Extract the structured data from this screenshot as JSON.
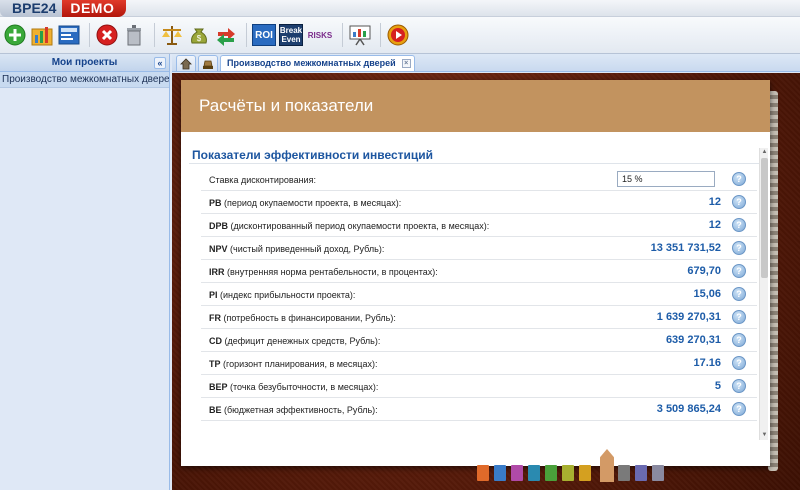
{
  "app": {
    "logo_main": "BPE24",
    "logo_badge": "DEMO"
  },
  "toolbar": {
    "buttons": [
      {
        "icon": "add-icon",
        "color": "#3aa83a"
      },
      {
        "icon": "chart-folder-icon",
        "color": "#f0a020"
      },
      {
        "icon": "plan-icon",
        "color": "#2a6bc0"
      },
      {
        "icon": "delete-icon",
        "color": "#d62020"
      },
      {
        "icon": "trash-icon",
        "color": "#8a8f96"
      },
      {
        "icon": "balance-scale-icon",
        "color": "#c58a1c"
      },
      {
        "icon": "money-bag-icon",
        "color": "#8a9a2a"
      },
      {
        "icon": "exchange-arrows-icon",
        "color": "#d63a2a"
      }
    ],
    "roi_label": "ROI",
    "breakeven_label": "Break Even",
    "risks_label": "RISKS"
  },
  "sidebar": {
    "title": "Мои проекты",
    "collapse_glyph": "«",
    "items": [
      "Производство межкомнатных дверей"
    ]
  },
  "tabs": {
    "active_label": "Производство межкомнатных дверей",
    "close_glyph": "×"
  },
  "panel": {
    "title": "Расчёты и показатели",
    "section_title": "Показатели эффективности инвестиций",
    "discount": {
      "label": "Ставка дисконтирования:",
      "value": "15 %"
    },
    "rows": [
      {
        "abbr": "PB",
        "desc": " (период окупаемости проекта, в месяцах):",
        "value": "12"
      },
      {
        "abbr": "DPB",
        "desc": " (дисконтированный период окупаемости проекта, в месяцах):",
        "value": "12"
      },
      {
        "abbr": "NPV",
        "desc": " (чистый приведенный доход, Рубль):",
        "value": "13 351 731,52"
      },
      {
        "abbr": "IRR",
        "desc": " (внутренняя норма рентабельности, в процентах):",
        "value": "679,70"
      },
      {
        "abbr": "PI",
        "desc": " (индекс прибыльности проекта):",
        "value": "15,06"
      },
      {
        "abbr": "FR",
        "desc": " (потребность в финансировании, Рубль):",
        "value": "1 639 270,31"
      },
      {
        "abbr": "CD",
        "desc": " (дефицит денежных средств, Рубль):",
        "value": "639 270,31"
      },
      {
        "abbr": "TP",
        "desc": " (горизонт планирования, в месяцах):",
        "value": "17.16"
      },
      {
        "abbr": "BEP",
        "desc": " (точка безубыточности, в месяцах):",
        "value": "5"
      },
      {
        "abbr": "BE",
        "desc": " (бюджетная эффективность, Рубль):",
        "value": "3 509 865,24"
      }
    ],
    "help_glyph": "?"
  },
  "bookmarks": {
    "colors": [
      "#e06a2a",
      "#3a7cc8",
      "#b04aa8",
      "#2a8ab0",
      "#4aa03a",
      "#a8b030",
      "#d4a020",
      "#7a7a7a",
      "#6a6ab0",
      "#8a8aa0"
    ],
    "active_color": "#d39a66"
  }
}
